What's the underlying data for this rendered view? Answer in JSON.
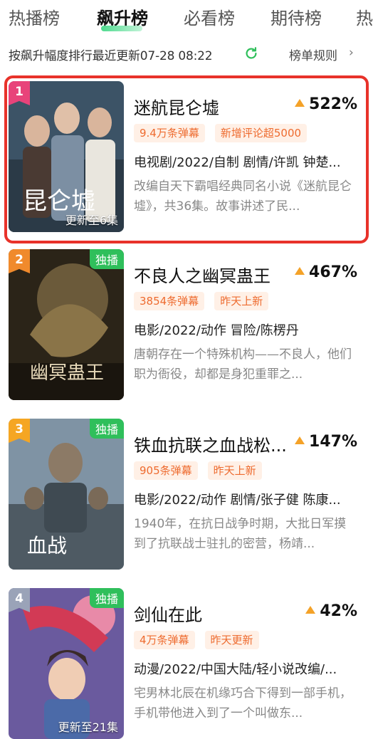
{
  "tabs": [
    "热播榜",
    "飙升榜",
    "必看榜",
    "期待榜",
    "热"
  ],
  "subbar": {
    "update_text": "按飙升幅度排行最近更新07-28 08:22",
    "rules_label": "榜单规则",
    "rules_arrow": "›",
    "refresh_icon": "refresh-icon"
  },
  "colors": {
    "accent_green": "#2fd37a",
    "highlight_red": "#e8322a",
    "tag_text": "#ee6b2f",
    "tag_bg": "#fff0e6",
    "rise_arrow": "#f4a228",
    "exclusive_bg": "#2fbf5b"
  },
  "items": [
    {
      "rank": "1",
      "rank_color": "#e8437a",
      "exclusive": "",
      "poster_caption": "更新至6集",
      "title": "迷航昆仑墟",
      "rise": "522%",
      "tags": [
        "9.4万条弹幕",
        "新增评论超5000"
      ],
      "meta": "电视剧/2022/自制 剧情/许凯 钟楚...",
      "desc": "改编自天下霸唱经典同名小说《迷航昆仑墟》，共36集。故事讲述了民...",
      "highlighted": true
    },
    {
      "rank": "2",
      "rank_color": "#f08a2c",
      "exclusive": "独播",
      "poster_caption": "",
      "title": "不良人之幽冥蛊王",
      "rise": "467%",
      "tags": [
        "3854条弹幕",
        "昨天上新"
      ],
      "meta": "电影/2022/动作 冒险/陈楞丹",
      "desc": "唐朝存在一个特殊机构——不良人，他们职为衙役，却都是身犯重罪之...",
      "highlighted": false
    },
    {
      "rank": "3",
      "rank_color": "#f5a623",
      "exclusive": "独播",
      "poster_caption": "",
      "title": "铁血抗联之血战松...",
      "rise": "147%",
      "tags": [
        "905条弹幕",
        "昨天上新"
      ],
      "meta": "电影/2022/动作 剧情/张子健 陈康...",
      "desc": "1940年，在抗日战争时期，大批日军摸到了抗联战士驻扎的密营，杨靖...",
      "highlighted": false
    },
    {
      "rank": "4",
      "rank_color": "#9aa3b8",
      "exclusive": "独播",
      "poster_caption": "更新至21集",
      "title": "剑仙在此",
      "rise": "42%",
      "tags": [
        "4万条弹幕",
        "昨天更新"
      ],
      "meta": "动漫/2022/中国大陆/轻小说改编/...",
      "desc": "宅男林北辰在机缘巧合下得到一部手机，手机带他进入到了一个叫做东...",
      "highlighted": false
    }
  ]
}
